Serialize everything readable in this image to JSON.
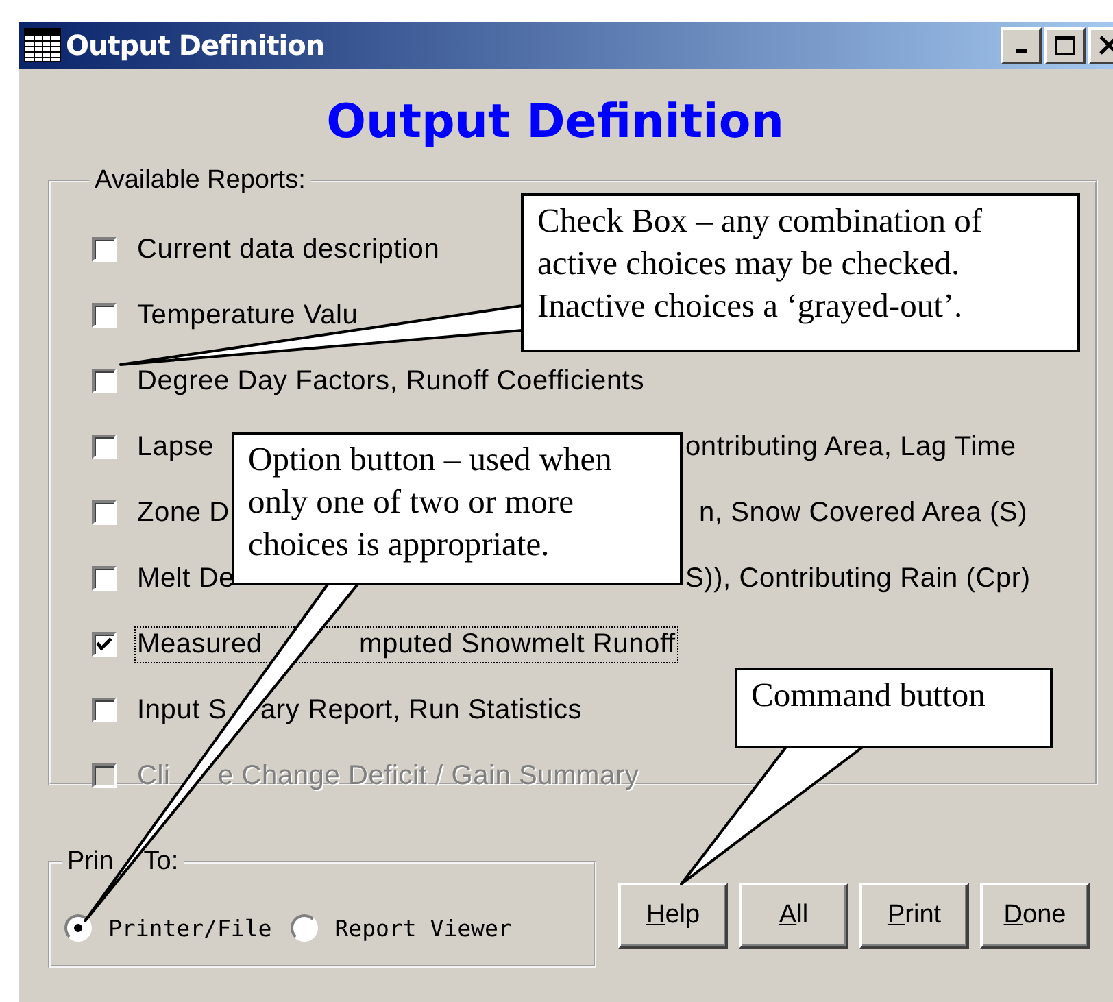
{
  "window": {
    "title": "Output Definition"
  },
  "heading": "Output Definition",
  "reports": {
    "legend": "Available Reports:",
    "items": [
      {
        "label_parts": [
          "Current data description"
        ],
        "checked": false,
        "disabled": false,
        "focused": false
      },
      {
        "label_parts": [
          "Temperature Valu"
        ],
        "checked": false,
        "disabled": false,
        "focused": false
      },
      {
        "label_parts": [
          "Degree Day Factors, Runoff Coefficients"
        ],
        "checked": false,
        "disabled": false,
        "focused": false
      },
      {
        "label_parts": [
          "Lapse",
          "ontributing Area, Lag Time"
        ],
        "checked": false,
        "disabled": false,
        "focused": false
      },
      {
        "label_parts": [
          "Zone D",
          "n, Snow Covered Area (S)"
        ],
        "checked": false,
        "disabled": false,
        "focused": false
      },
      {
        "label_parts": [
          "Melt De",
          "S)), Contributing Rain (Cpr)"
        ],
        "checked": false,
        "disabled": false,
        "focused": false
      },
      {
        "label_parts": [
          "Measured",
          "mputed Snowmelt Runoff"
        ],
        "checked": true,
        "disabled": false,
        "focused": true
      },
      {
        "label_parts": [
          "Input S",
          "ary Report, Run Statistics"
        ],
        "checked": false,
        "disabled": false,
        "focused": false
      },
      {
        "label_parts": [
          "Cli",
          "e Change Deficit / Gain Summary"
        ],
        "checked": false,
        "disabled": true,
        "focused": false
      }
    ]
  },
  "print_to": {
    "legend_parts": [
      "Prin",
      "To:"
    ],
    "options": [
      {
        "label": "Printer/File",
        "selected": true
      },
      {
        "label": "Report Viewer",
        "selected": false
      }
    ]
  },
  "buttons": [
    {
      "label": "Help",
      "mnemonic": true
    },
    {
      "label": "All",
      "mnemonic": true
    },
    {
      "label": "Print",
      "mnemonic": true
    },
    {
      "label": "Done",
      "mnemonic": true
    }
  ],
  "callouts": [
    {
      "text": "Check Box – any combination of active choices may be checked. Inactive choices a ‘grayed-out’."
    },
    {
      "text": "Option button – used when only one of two or more choices is appropriate."
    },
    {
      "text": "Command button"
    }
  ]
}
